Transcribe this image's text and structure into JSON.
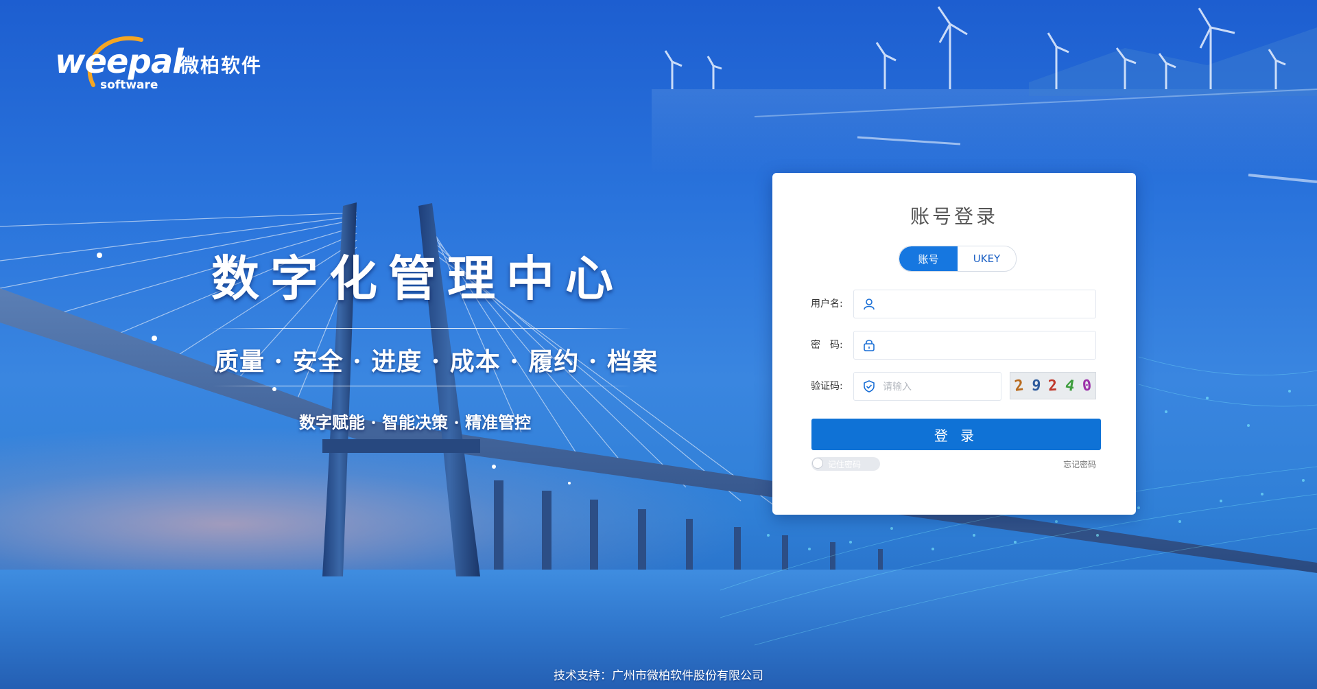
{
  "brand": {
    "logo_word": "weepal",
    "logo_sub": "software",
    "logo_cn": "微柏软件"
  },
  "hero": {
    "headline": "数字化管理中心",
    "subline": "质量 · 安全 · 进度 · 成本 · 履约 · 档案",
    "tagline": "数字赋能 · 智能决策 · 精准管控"
  },
  "login": {
    "title": "账号登录",
    "tabs": [
      {
        "label": "账号",
        "active": true
      },
      {
        "label": "UKEY",
        "active": false
      }
    ],
    "username": {
      "label": "用户名:",
      "value": "",
      "placeholder": "",
      "icon": "user-icon"
    },
    "password": {
      "label": "密　码:",
      "value": "",
      "placeholder": "",
      "icon": "lock-icon"
    },
    "captcha": {
      "label": "验证码:",
      "value": "",
      "placeholder": "请输入",
      "icon": "shield-check-icon",
      "code": [
        "2",
        "9",
        "2",
        "4",
        "0"
      ],
      "code_colors": [
        "#b86a1e",
        "#2d5a9c",
        "#c0392b",
        "#3e9e3e",
        "#9b2fa8"
      ]
    },
    "submit_label": "登 录",
    "remember_label": "记住密码",
    "remember_on": false,
    "forgot_label": "忘记密码"
  },
  "footer": {
    "text": "技术支持：广州市微柏软件股份有限公司"
  },
  "colors": {
    "primary": "#0f72d6",
    "tab_active": "#1677e0"
  }
}
